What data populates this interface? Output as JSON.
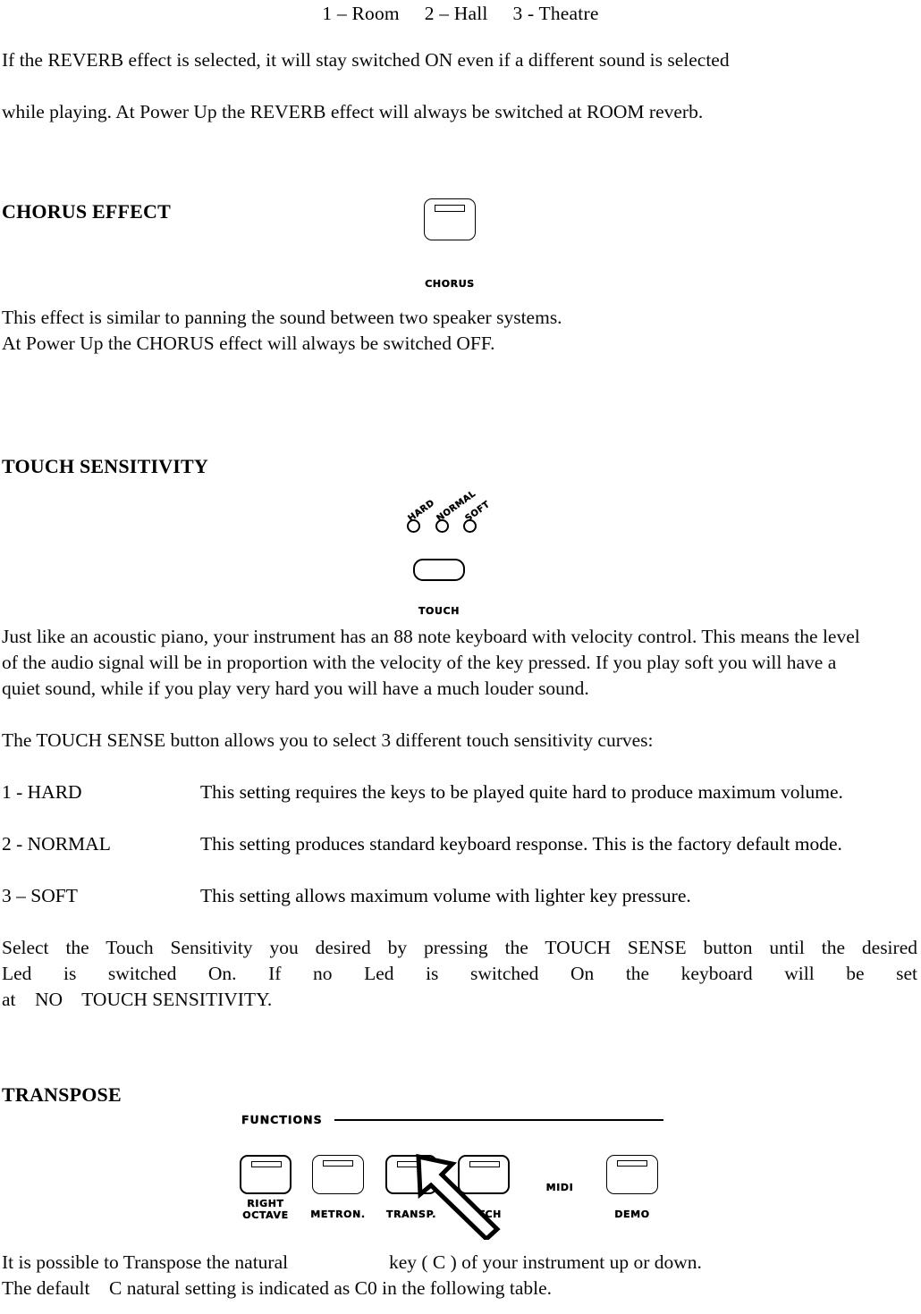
{
  "document": {
    "reverb_modes_line": "1 – Room     2 – Hall     3 - Theatre",
    "reverb_paragraph_line1": "If the REVERB effect is selected, it will stay switched ON even if a different sound is  selected",
    "reverb_paragraph_line2": "while playing. At Power Up the REVERB effect will always be switched at ROOM reverb."
  },
  "chorus_section": {
    "heading": "CHORUS EFFECT",
    "button_label": "CHORUS",
    "paragraph_line1": "This effect is similar to panning the sound between two speaker systems.",
    "paragraph_line2": "At Power Up the CHORUS effect will always be switched OFF."
  },
  "touch_section": {
    "heading": "TOUCH SENSITIVITY",
    "led_labels": [
      "HARD",
      "NORMAL",
      "SOFT"
    ],
    "button_label": "TOUCH",
    "paragraph": "Just like an acoustic piano, your instrument has an 88 note keyboard with velocity control. This means the level of the audio signal will be in proportion with the velocity of the key pressed. If you play soft you will have a quiet sound, while if you play very hard you will have a much louder sound.",
    "curves_intro": "The TOUCH SENSE button allows you to select 3 different touch sensitivity curves:",
    "curves": [
      {
        "label": "1 - HARD",
        "description": "This setting requires the keys to be played quite hard to produce maximum volume."
      },
      {
        "label": "2 - NORMAL",
        "description": "This setting produces standard keyboard response. This is the factory default mode."
      },
      {
        "label": "3 – SOFT",
        "description": "This setting allows maximum volume with lighter key pressure."
      }
    ],
    "select_paragraph_line1": "Select the Touch Sensitivity you desired by pressing the TOUCH SENSE button until the desired",
    "select_paragraph_line2": "Led is switched On. If no Led is switched On the keyboard will be set",
    "select_paragraph_line3": "at    NO    TOUCH SENSITIVITY."
  },
  "transpose_section": {
    "heading": "TRANSPOSE",
    "panel": {
      "group_label": "FUNCTIONS",
      "midi_label": "MIDI",
      "buttons": [
        {
          "label": "RIGHT\nOCTAVE",
          "has_led": true
        },
        {
          "label": "METRON.",
          "has_led": true
        },
        {
          "label": "TRANSP.",
          "has_led": true
        },
        {
          "label": "PITCH",
          "has_led": true
        },
        {
          "label": "DEMO",
          "has_led": true
        }
      ],
      "cursor_target": "TRANSP."
    },
    "paragraph_line1": "It is possible to Transpose the natural                     key ( C ) of your instrument up or down.",
    "paragraph_line2": "The default    C natural setting is indicated as C0 in the following table."
  },
  "colors": {
    "ink": "#000000",
    "paper": "#ffffff"
  }
}
